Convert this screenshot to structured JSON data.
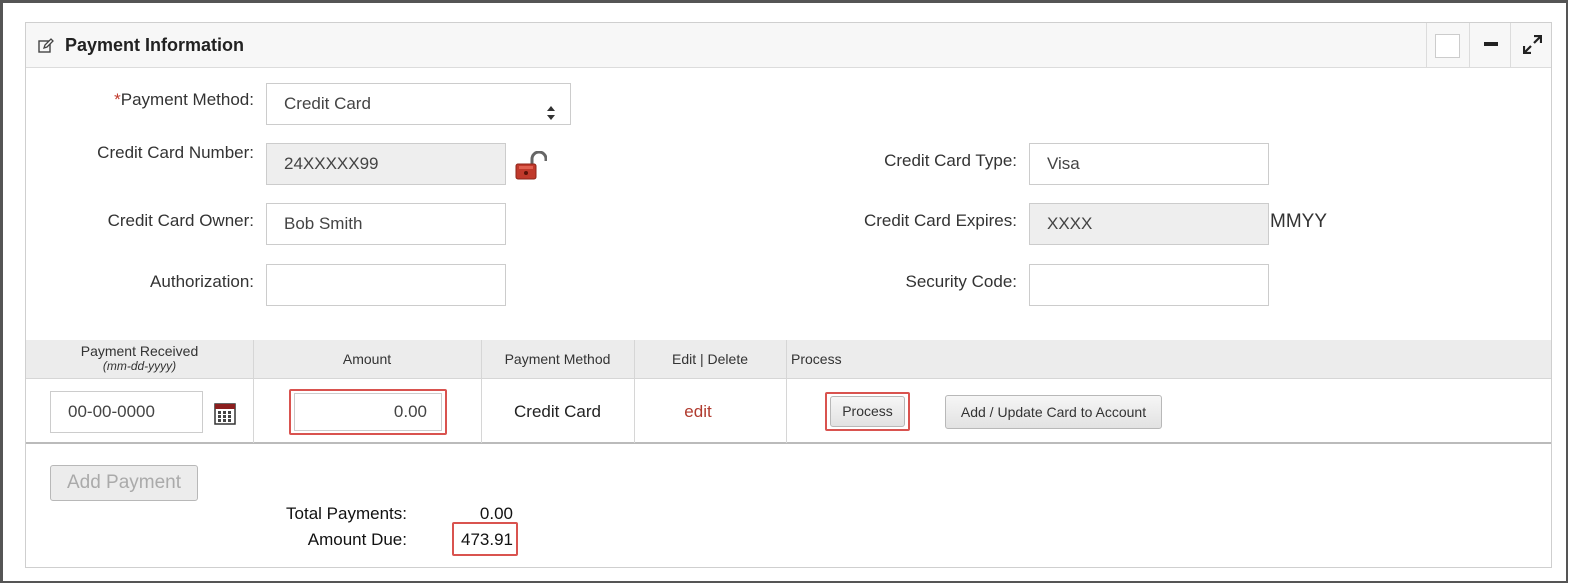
{
  "panel": {
    "title": "Payment Information",
    "icons": [
      "edit-icon",
      "square-icon",
      "minus-icon",
      "expand-icon"
    ]
  },
  "form": {
    "payment_method_label": "Payment Method:",
    "payment_method_required": "*",
    "payment_method_value": "Credit Card",
    "cc_number_label": "Credit Card Number:",
    "cc_number_value": "24XXXXX99",
    "cc_owner_label": "Credit Card Owner:",
    "cc_owner_value": "Bob Smith",
    "authorization_label": "Authorization:",
    "authorization_value": "",
    "cc_type_label": "Credit Card Type:",
    "cc_type_value": "Visa",
    "cc_expires_label": "Credit Card Expires:",
    "cc_expires_value": "XXXX",
    "cc_expires_format": "MMYY",
    "security_code_label": "Security Code:",
    "security_code_value": ""
  },
  "table": {
    "headers": {
      "received": "Payment Received",
      "received_format": "(mm-dd-yyyy)",
      "amount": "Amount",
      "method": "Payment Method",
      "edit_delete": "Edit | Delete",
      "process": "Process"
    },
    "row": {
      "date": "00-00-0000",
      "amount": "0.00",
      "method": "Credit Card",
      "edit": "edit",
      "process_button": "Process",
      "add_card_button": "Add / Update Card to Account"
    }
  },
  "footer": {
    "add_payment_button": "Add Payment",
    "total_payments_label": "Total Payments:",
    "total_payments_value": "0.00",
    "amount_due_label": "Amount Due:",
    "amount_due_value": "473.91"
  },
  "colors": {
    "required": "#c0392b",
    "edit_link": "#b03a2e",
    "highlight": "#d9534f",
    "lock": "#c0392b"
  }
}
